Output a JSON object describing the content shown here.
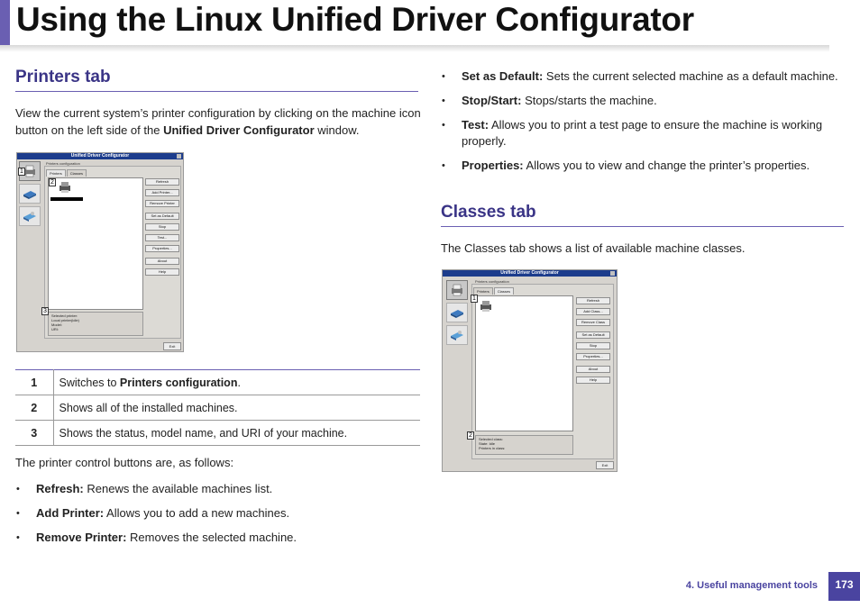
{
  "title": "Using the Linux Unified Driver Configurator",
  "printers_tab": {
    "heading": "Printers tab",
    "intro_1": "View the current system’s printer configuration by clicking on the machine icon",
    "intro_2_pre": "button on the left side of the ",
    "intro_2_bold": "Unified Driver Configurator",
    "intro_2_post": " window.",
    "screenshot": {
      "window_title": "Unified Driver Configurator",
      "panel_label": "Printers configuration",
      "tabs": [
        "Printers",
        "Classes"
      ],
      "buttons": [
        "Refresh",
        "Add Printer...",
        "Remove Printer",
        "Set as Default",
        "Stop",
        "Test...",
        "Properties...",
        "About",
        "Help"
      ],
      "status_lines": [
        "Selected printer:",
        "Local printer(idle)",
        "Model:",
        "URI:"
      ],
      "exit_label": "Exit",
      "callouts": [
        "1",
        "2",
        "3"
      ]
    },
    "legend": [
      {
        "num": "1",
        "pre": "Switches to ",
        "bold": "Printers configuration",
        "post": "."
      },
      {
        "num": "2",
        "pre": "Shows all of the installed machines.",
        "bold": "",
        "post": ""
      },
      {
        "num": "3",
        "pre": "Shows the status, model name, and URI of your machine.",
        "bold": "",
        "post": ""
      }
    ],
    "buttons_intro": "The printer control buttons are, as follows:",
    "bullets": [
      {
        "label": "Refresh:",
        "text": " Renews the available machines list."
      },
      {
        "label": "Add Printer:",
        "text": " Allows you to add a new machines."
      },
      {
        "label": "Remove Printer:",
        "text": " Removes the selected machine."
      }
    ]
  },
  "right_bullets": [
    {
      "label": "Set as Default:",
      "text": " Sets the current selected machine as a default machine."
    },
    {
      "label": "Stop/Start:",
      "text": " Stops/starts the machine."
    },
    {
      "label": "Test:",
      "text": " Allows you to print a test page to ensure the machine is working properly."
    },
    {
      "label": "Properties:",
      "text": " Allows you to view and change the printer’s properties."
    }
  ],
  "classes_tab": {
    "heading": "Classes tab",
    "intro": "The Classes tab shows a list of available machine classes.",
    "screenshot": {
      "window_title": "Unified Driver Configurator",
      "panel_label": "Printers configuration",
      "tabs": [
        "Printers",
        "Classes"
      ],
      "buttons": [
        "Refresh",
        "Add Class...",
        "Remove Class",
        "Set as Default",
        "Stop",
        "Properties...",
        "About",
        "Help"
      ],
      "status_lines": [
        "Selected class:",
        "State: Idle",
        "Printers in class:"
      ],
      "exit_label": "Exit",
      "callouts": [
        "1",
        "2"
      ]
    }
  },
  "footer": {
    "section": "4.  Useful management tools",
    "page": "173"
  },
  "colors": {
    "accent": "#4a44a0",
    "heading": "#3a3486"
  }
}
